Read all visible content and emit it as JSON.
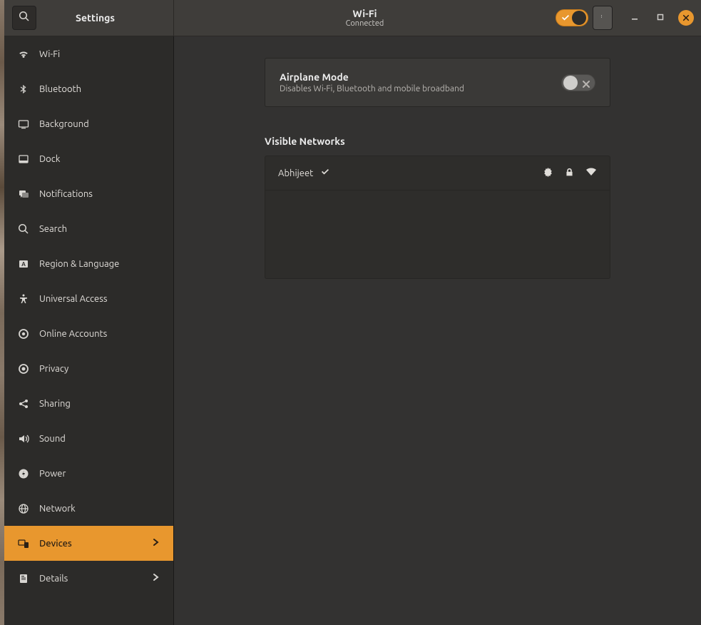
{
  "app": {
    "title": "Settings"
  },
  "header": {
    "page_title": "Wi-Fi",
    "page_subtitle": "Connected",
    "wifi_enabled": true
  },
  "sidebar": {
    "items": [
      {
        "label": "Wi-Fi",
        "icon": "wifi-icon"
      },
      {
        "label": "Bluetooth",
        "icon": "bluetooth-icon"
      },
      {
        "label": "Background",
        "icon": "background-icon"
      },
      {
        "label": "Dock",
        "icon": "dock-icon"
      },
      {
        "label": "Notifications",
        "icon": "notifications-icon"
      },
      {
        "label": "Search",
        "icon": "search-icon"
      },
      {
        "label": "Region & Language",
        "icon": "region-language-icon"
      },
      {
        "label": "Universal Access",
        "icon": "universal-access-icon"
      },
      {
        "label": "Online Accounts",
        "icon": "online-accounts-icon"
      },
      {
        "label": "Privacy",
        "icon": "privacy-icon"
      },
      {
        "label": "Sharing",
        "icon": "sharing-icon"
      },
      {
        "label": "Sound",
        "icon": "sound-icon"
      },
      {
        "label": "Power",
        "icon": "power-icon"
      },
      {
        "label": "Network",
        "icon": "network-icon"
      },
      {
        "label": "Devices",
        "icon": "devices-icon",
        "has_arrow": true,
        "selected": true
      },
      {
        "label": "Details",
        "icon": "details-icon",
        "has_arrow": true
      }
    ]
  },
  "main": {
    "airplane": {
      "title": "Airplane Mode",
      "description": "Disables Wi-Fi, Bluetooth and mobile broadband",
      "enabled": false
    },
    "visible_networks": {
      "header": "Visible Networks",
      "items": [
        {
          "name": "Abhijeet",
          "connected": true,
          "secure": true,
          "strength": "full"
        }
      ]
    }
  },
  "colors": {
    "accent": "#e8972e",
    "background": "#333231",
    "sidebar": "#2c2b29",
    "panel": "#3a3937"
  }
}
